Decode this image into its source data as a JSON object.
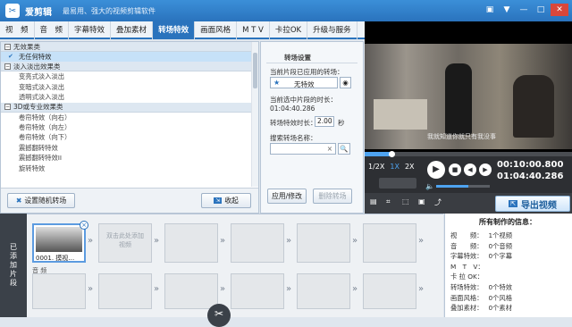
{
  "app": {
    "name": "爱剪辑",
    "slogan": "最易用、强大的视频剪辑软件"
  },
  "tabs": [
    "视　频",
    "音　频",
    "字幕特效",
    "叠加素材",
    "转场特效",
    "画面风格",
    "M T V",
    "卡拉OK",
    "升级与服务"
  ],
  "active_tab": 4,
  "categories": [
    {
      "name": "无效果类",
      "items": [
        "无任何特效"
      ]
    },
    {
      "name": "淡入淡出效果类",
      "items": [
        "变亮式淡入淡出",
        "变暗式淡入淡出",
        "透明式淡入淡出"
      ]
    },
    {
      "name": "3D或专业效果类",
      "items": [
        "卷帘特效（向右）",
        "卷帘特效（向左）",
        "卷帘特效（向下）",
        "震撼翻转特效",
        "震撼翻转特效II",
        "旋转特效"
      ]
    }
  ],
  "left_buttons": {
    "random": "设置随机转场",
    "collapse": "收起"
  },
  "settings": {
    "title": "转场设置",
    "applied_label": "当前片段已应用的转场：",
    "applied_value": "无特效",
    "duration_label": "当前选中片段的时长：",
    "duration_value": "01:04:40.286",
    "effect_duration_label": "转场特效时长：",
    "effect_duration_value": "2.00",
    "effect_duration_unit": "秒",
    "search_label": "搜索转场名称：",
    "search_value": "",
    "apply_btn": "应用/修改",
    "delete_btn": "删除转场"
  },
  "player": {
    "subtitle": "我就知道你就只有我没事",
    "speeds": [
      "1/2X",
      "1X",
      "2X"
    ],
    "active_speed": 1,
    "current_time": "00:10:00.800",
    "total_time": "01:04:40.286",
    "progress": 0.13,
    "volume": 0.6,
    "export_label": "导出视频"
  },
  "timeline": {
    "side_label": "已添加片段",
    "clip_name": "0001. 摸视…",
    "placeholder": "双击此处添加视频",
    "audio_label": "音 频"
  },
  "info": {
    "title": "所有制作的信息：",
    "rows": [
      {
        "k": "视　　频：",
        "v": "1个视频"
      },
      {
        "k": "音　　频：",
        "v": "0个音频"
      },
      {
        "k": "字幕特效：",
        "v": "0个字幕"
      },
      {
        "k": "M　T　V：",
        "v": ""
      },
      {
        "k": "卡 拉 OK：",
        "v": ""
      },
      {
        "k": "转场特效：",
        "v": "0个特效"
      },
      {
        "k": "画面风格：",
        "v": "0个风格"
      },
      {
        "k": "叠加素材：",
        "v": "0个素材"
      }
    ]
  }
}
